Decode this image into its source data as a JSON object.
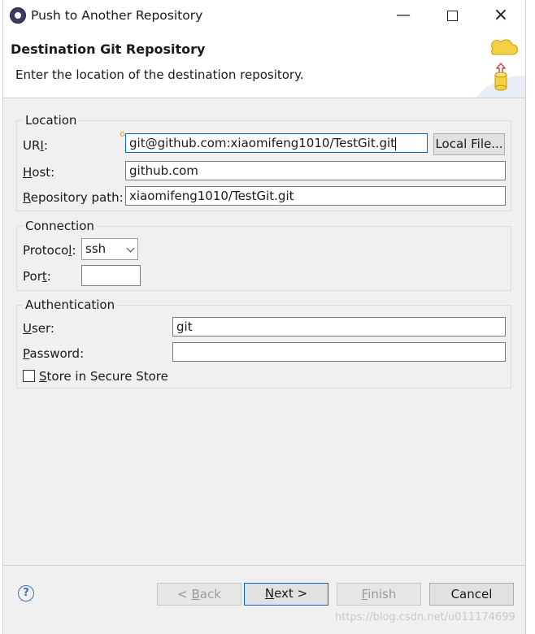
{
  "window": {
    "title": "Push to Another Repository"
  },
  "header": {
    "title": "Destination Git Repository",
    "description": "Enter the location of the destination repository."
  },
  "location": {
    "legend": "Location",
    "uri_label_pre": "UR",
    "uri_label_acc": "I",
    "uri_label_post": ":",
    "uri_value": "git@github.com:xiaomifeng1010/TestGit.git",
    "local_file_button": "Local File...",
    "host_label_acc": "H",
    "host_label_post": "ost:",
    "host_value": "github.com",
    "repo_label_acc": "R",
    "repo_label_post": "epository path:",
    "repo_value": "xiaomifeng1010/TestGit.git"
  },
  "connection": {
    "legend": "Connection",
    "protocol_label_pre": "Protoco",
    "protocol_label_acc": "l",
    "protocol_label_post": ":",
    "protocol_value": "ssh",
    "port_label_pre": "Por",
    "port_label_acc": "t",
    "port_label_post": ":",
    "port_value": ""
  },
  "authentication": {
    "legend": "Authentication",
    "user_label_acc": "U",
    "user_label_post": "ser:",
    "user_value": "git",
    "password_label_acc": "P",
    "password_label_post": "assword:",
    "password_value": "",
    "store_label_acc": "S",
    "store_label_post": "tore in Secure Store"
  },
  "footer": {
    "help": "?",
    "back_pre": "< ",
    "back_acc": "B",
    "back_post": "ack",
    "next_acc": "N",
    "next_post": "ext >",
    "finish_acc": "F",
    "finish_post": "inish",
    "cancel": "Cancel"
  },
  "watermark": "https://blog.csdn.net/u011174699",
  "colors": {
    "focus": "#0a64c8",
    "dialog_bg": "#f0f0f0",
    "header_bg": "#ffffff"
  }
}
